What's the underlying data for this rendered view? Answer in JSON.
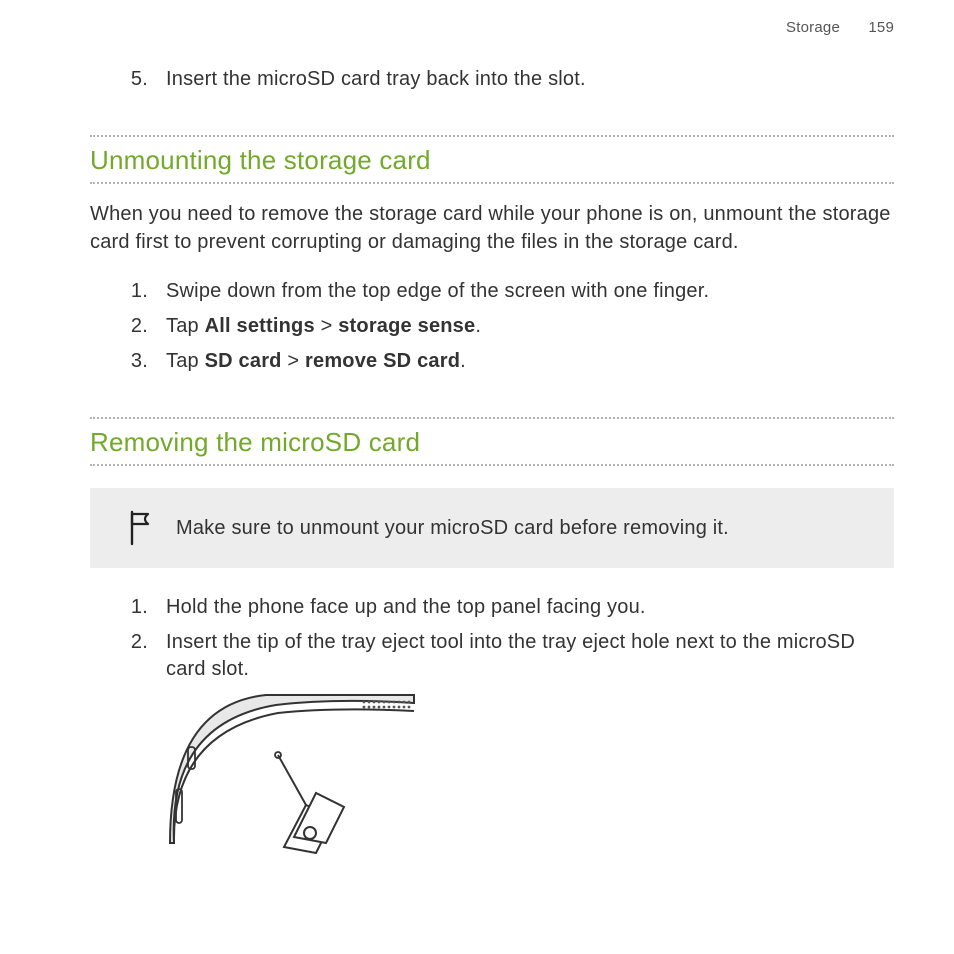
{
  "header": {
    "section": "Storage",
    "page": "159"
  },
  "pre_list": {
    "num": "5.",
    "text": "Insert the microSD card tray back into the slot."
  },
  "section1": {
    "heading": "Unmounting the storage card",
    "intro": "When you need to remove the storage card while your phone is on, unmount the storage card first to prevent corrupting or damaging the files in the storage card.",
    "steps": [
      {
        "num": "1.",
        "text": "Swipe down from the top edge of the screen with one finger."
      },
      {
        "num": "2.",
        "pre": "Tap ",
        "b1": "All settings",
        "mid": " > ",
        "b2": "storage sense",
        "post": "."
      },
      {
        "num": "3.",
        "pre": "Tap ",
        "b1": "SD card",
        "mid": " > ",
        "b2": "remove SD card",
        "post": "."
      }
    ]
  },
  "section2": {
    "heading": "Removing the microSD card",
    "note": "Make sure to unmount your microSD card before removing it.",
    "steps": [
      {
        "num": "1.",
        "text": "Hold the phone face up and the top panel facing you."
      },
      {
        "num": "2.",
        "text": "Insert the tip of the tray eject tool into the tray eject hole next to the microSD card slot."
      }
    ]
  }
}
